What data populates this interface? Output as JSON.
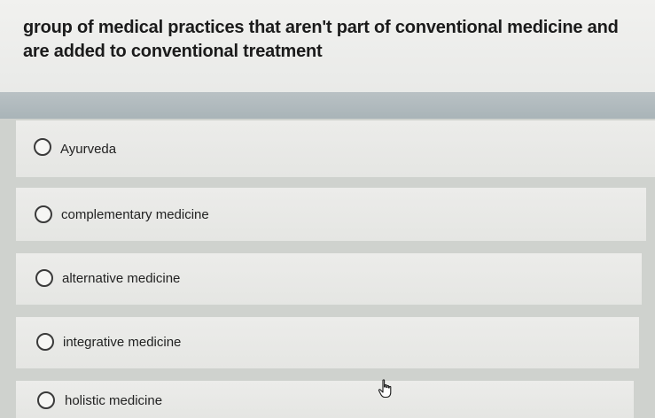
{
  "question": {
    "text": "group of medical practices that aren't part of conventional medicine and are added to conventional treatment"
  },
  "options": [
    {
      "label": "Ayurveda"
    },
    {
      "label": "complementary medicine"
    },
    {
      "label": "alternative medicine"
    },
    {
      "label": "integrative medicine"
    },
    {
      "label": "holistic medicine"
    }
  ],
  "icons": {
    "cursor": "hand-pointer-icon"
  },
  "colors": {
    "question_bg": "#eeeeec",
    "band": "#b0babd",
    "option_bg": "#e9e9e7",
    "text": "#1b1b1b"
  }
}
